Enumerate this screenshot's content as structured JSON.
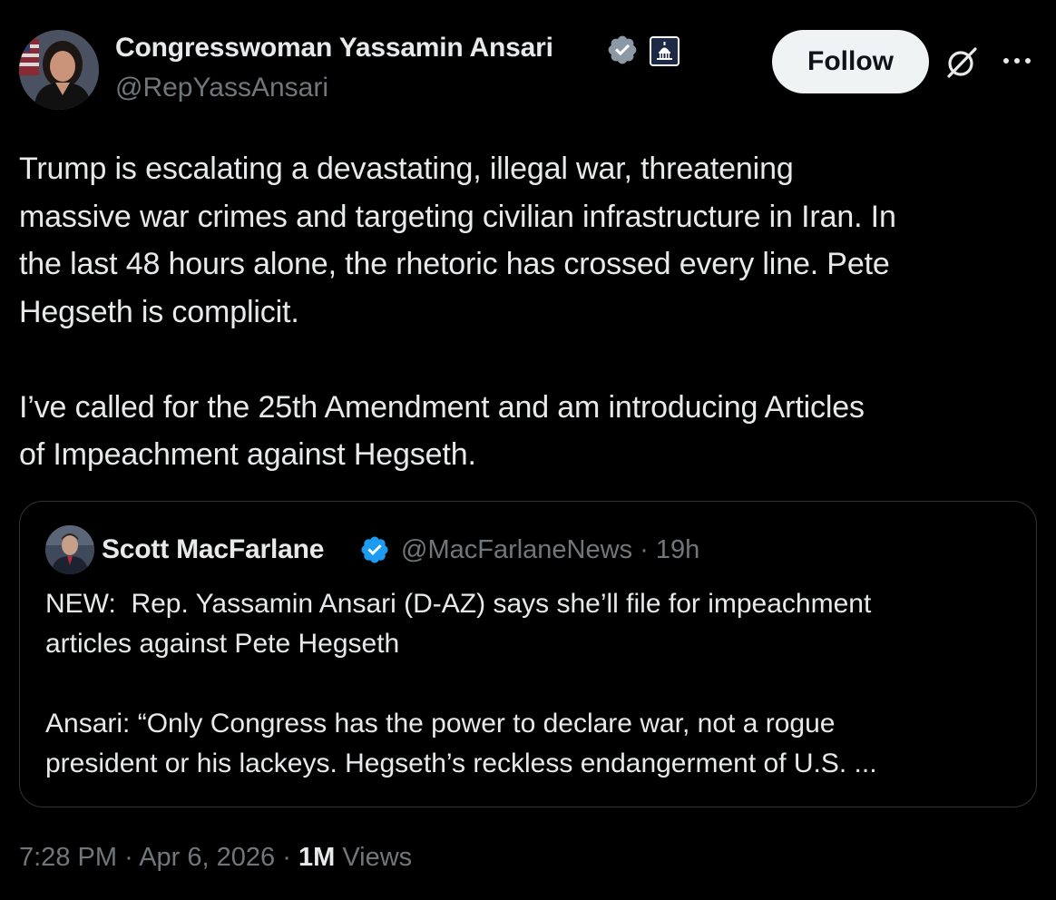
{
  "author": {
    "display_name": "Congresswoman Yassamin Ansari",
    "handle": "@RepYassAnsari",
    "verified_badge_color": "#1d9bf0",
    "avatar_icon": "person-avatar",
    "affiliation_badge_icon": "capitol-dome-icon"
  },
  "header_actions": {
    "follow_label": "Follow",
    "grok_icon": "grok-icon",
    "more_icon": "more-options-icon"
  },
  "tweet": {
    "text": "Trump is escalating a devastating, illegal war, threatening\nmassive war crimes and targeting civilian infrastructure in Iran. In\nthe last 48 hours alone, the rhetoric has crossed every line. Pete\nHegseth is complicit.\n\nI’ve called for the 25th Amendment and am introducing Articles\nof Impeachment against Hegseth."
  },
  "quote": {
    "display_name": "Scott MacFarlane",
    "handle": "@MacFarlaneNews",
    "separator": "·",
    "time_ago": "19h",
    "text": "NEW:  Rep. Yassamin Ansari (D-AZ) says she’ll file for impeachment\narticles against Pete Hegseth\n\nAnsari: “Only Congress has the power to declare war, not a rogue\npresident or his lackeys. Hegseth’s reckless endangerment of U.S. ..."
  },
  "footer": {
    "time": "7:28 PM",
    "separator": "·",
    "date": "Apr 6, 2026",
    "views_count": "1M",
    "views_label": "Views"
  },
  "colors": {
    "background": "#000000",
    "primary_text": "#e7e9ea",
    "secondary_text": "#71767b",
    "border": "#2f3336",
    "follow_button_bg": "#eff3f4",
    "verified_blue": "#1d9bf0"
  }
}
